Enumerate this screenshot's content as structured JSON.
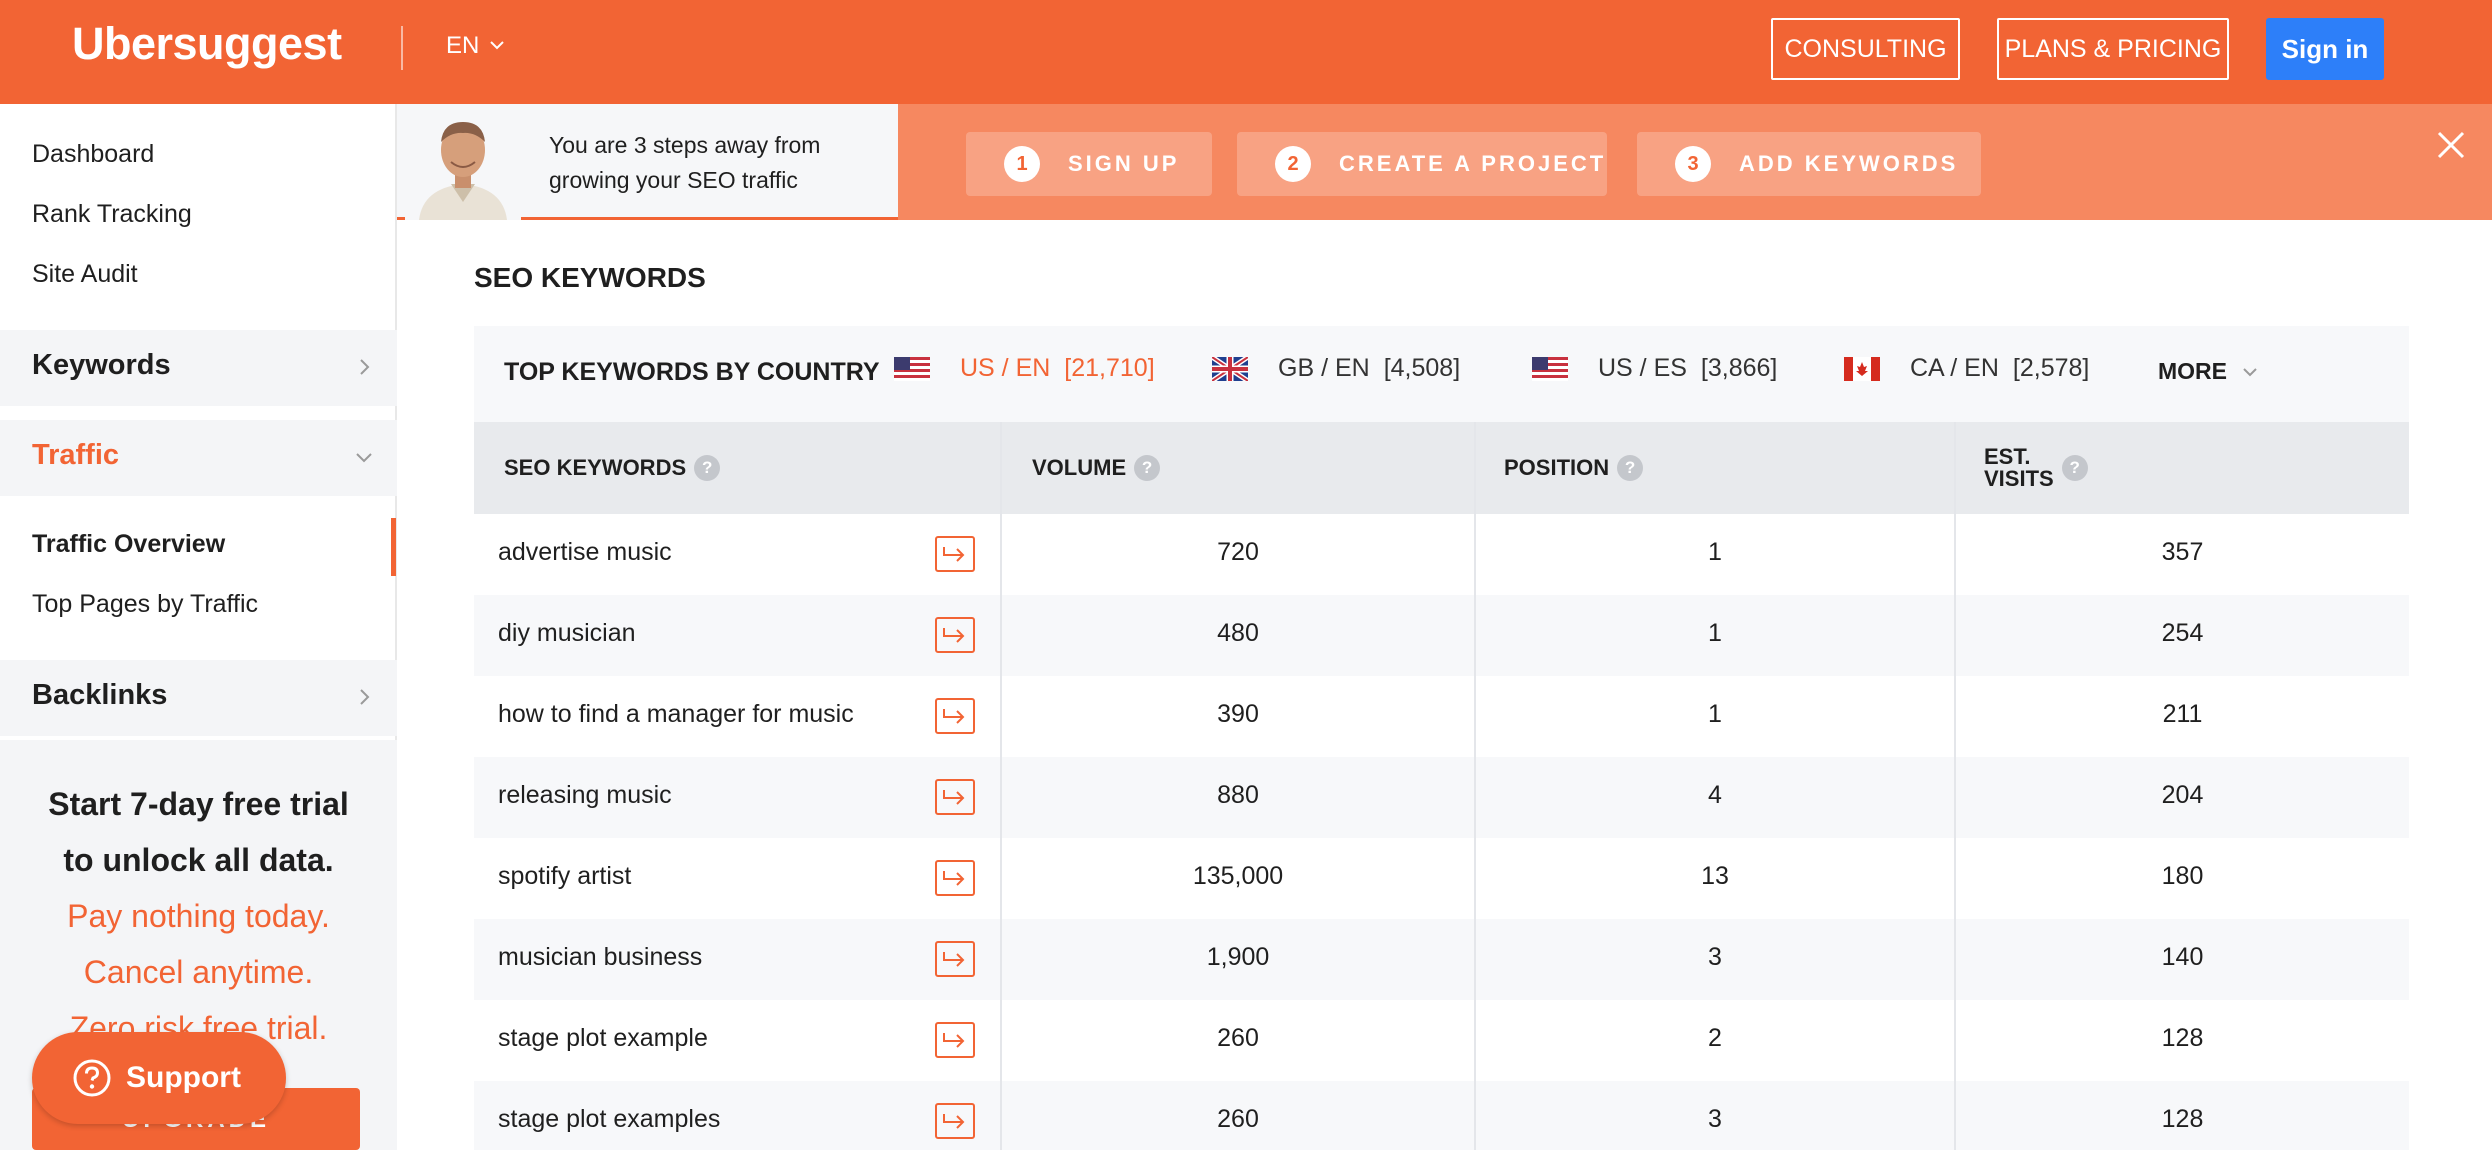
{
  "header": {
    "logo": "Ubersuggest",
    "language": "EN",
    "consulting_label": "CONSULTING",
    "plans_label": "PLANS & PRICING",
    "signin_label": "Sign in"
  },
  "sidebar": {
    "links": [
      "Dashboard",
      "Rank Tracking",
      "Site Audit"
    ],
    "sections": {
      "keywords": "Keywords",
      "traffic": "Traffic",
      "backlinks": "Backlinks"
    },
    "traffic_items": [
      "Traffic Overview",
      "Top Pages by Traffic"
    ],
    "active_item": "Traffic Overview",
    "trial": {
      "line1": "Start 7-day free trial",
      "line2": "to unlock all data.",
      "line3": "Pay nothing today.",
      "line4": "Cancel anytime.",
      "line5": "Zero risk free trial."
    },
    "upgrade_label": "UPGRADE",
    "support_label": "Support"
  },
  "banner": {
    "line1": "You are 3 steps away from",
    "line2": "growing your SEO traffic",
    "steps": [
      {
        "num": "1",
        "label": "SIGN UP"
      },
      {
        "num": "2",
        "label": "CREATE A PROJECT"
      },
      {
        "num": "3",
        "label": "ADD KEYWORDS"
      }
    ]
  },
  "main": {
    "title": "SEO KEYWORDS",
    "country_title": "TOP KEYWORDS BY COUNTRY",
    "countries": [
      {
        "code": "US / EN",
        "count": "[21,710]",
        "flag": "us-flag",
        "active": true
      },
      {
        "code": "GB / EN",
        "count": "[4,508]",
        "flag": "gb-flag",
        "active": false
      },
      {
        "code": "US / ES",
        "count": "[3,866]",
        "flag": "us-flag",
        "active": false
      },
      {
        "code": "CA / EN",
        "count": "[2,578]",
        "flag": "ca-flag",
        "active": false
      }
    ],
    "more_label": "MORE",
    "columns": {
      "keyword": "SEO KEYWORDS",
      "volume": "VOLUME",
      "position": "POSITION",
      "visits_line1": "EST.",
      "visits_line2": "VISITS"
    },
    "rows": [
      {
        "keyword": "advertise music",
        "volume": "720",
        "position": "1",
        "visits": "357"
      },
      {
        "keyword": "diy musician",
        "volume": "480",
        "position": "1",
        "visits": "254"
      },
      {
        "keyword": "how to find a manager for music",
        "volume": "390",
        "position": "1",
        "visits": "211"
      },
      {
        "keyword": "releasing music",
        "volume": "880",
        "position": "4",
        "visits": "204"
      },
      {
        "keyword": "spotify artist",
        "volume": "135,000",
        "position": "13",
        "visits": "180"
      },
      {
        "keyword": "musician business",
        "volume": "1,900",
        "position": "3",
        "visits": "140"
      },
      {
        "keyword": "stage plot example",
        "volume": "260",
        "position": "2",
        "visits": "128"
      },
      {
        "keyword": "stage plot examples",
        "volume": "260",
        "position": "3",
        "visits": "128"
      }
    ]
  },
  "colors": {
    "brand_orange": "#f26434",
    "banner_orange": "#f68860",
    "signin_blue": "#2d7ff9"
  }
}
